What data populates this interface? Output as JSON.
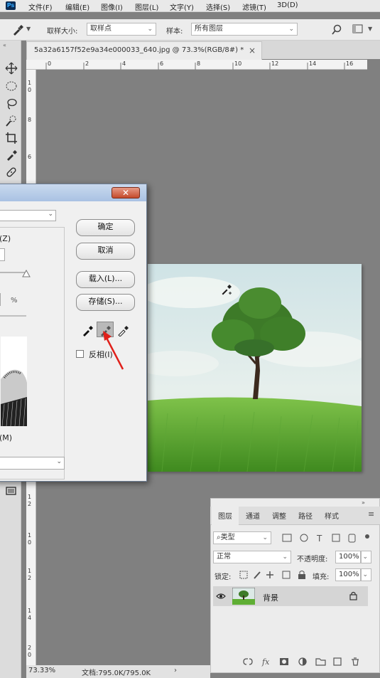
{
  "menubar": {
    "logo": "Ps",
    "items": [
      "文件(F)",
      "编辑(E)",
      "图像(I)",
      "图层(L)",
      "文字(Y)",
      "选择(S)",
      "滤镜(T)",
      "3D(D)"
    ]
  },
  "options": {
    "sample_size_label": "取样大小:",
    "sample_size_value": "取样点",
    "sample_label": "样本:",
    "sample_value": "所有图层"
  },
  "document": {
    "tab_title": "5a32a6157f52e9a34e000033_640.jpg @ 73.3%(RGB/8#) *",
    "close": "×"
  },
  "rulers": {
    "h_ticks": [
      "0",
      "2",
      "4",
      "6",
      "8",
      "10",
      "12",
      "14",
      "16"
    ],
    "v_ticks": [
      "1",
      "0",
      "8",
      "6",
      "1",
      "2",
      "4",
      "6",
      "8",
      "1",
      "0",
      "1",
      "2",
      "1",
      "4",
      "1",
      "6",
      "1",
      "8",
      "2",
      "0"
    ]
  },
  "dialog": {
    "close_glyph": "✕",
    "label_z": "(Z)",
    "pct": "%",
    "ok": "确定",
    "cancel": "取消",
    "load": "载入(L)...",
    "save": "存储(S)...",
    "invert": "反相(I)",
    "label_m": "(M)"
  },
  "layers": {
    "tabs": [
      "图层",
      "通道",
      "调整",
      "路径",
      "样式"
    ],
    "filter_placeholder": "类型",
    "blend_mode": "正常",
    "opacity_label": "不透明度:",
    "opacity_value": "100%",
    "lock_label": "锁定:",
    "fill_label": "填充:",
    "fill_value": "100%",
    "layer_name": "背景"
  },
  "status": {
    "zoom": "73.33%",
    "doc_info": "文档:795.0K/795.0K"
  }
}
